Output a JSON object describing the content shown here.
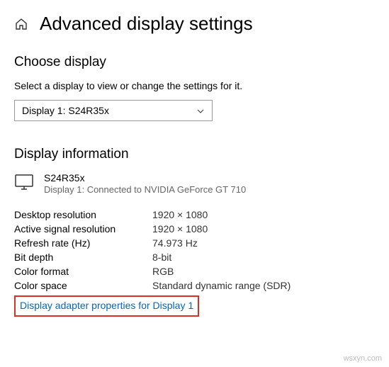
{
  "header": {
    "title": "Advanced display settings"
  },
  "choose": {
    "heading": "Choose display",
    "instruction": "Select a display to view or change the settings for it.",
    "selected": "Display 1: S24R35x"
  },
  "info": {
    "heading": "Display information",
    "display_name": "S24R35x",
    "connection": "Display 1: Connected to NVIDIA GeForce GT 710",
    "rows": [
      {
        "label": "Desktop resolution",
        "value": "1920 × 1080"
      },
      {
        "label": "Active signal resolution",
        "value": "1920 × 1080"
      },
      {
        "label": "Refresh rate (Hz)",
        "value": "74.973 Hz"
      },
      {
        "label": "Bit depth",
        "value": "8-bit"
      },
      {
        "label": "Color format",
        "value": "RGB"
      },
      {
        "label": "Color space",
        "value": "Standard dynamic range (SDR)"
      }
    ],
    "link": "Display adapter properties for Display 1"
  },
  "watermark": "wsxyn.com"
}
